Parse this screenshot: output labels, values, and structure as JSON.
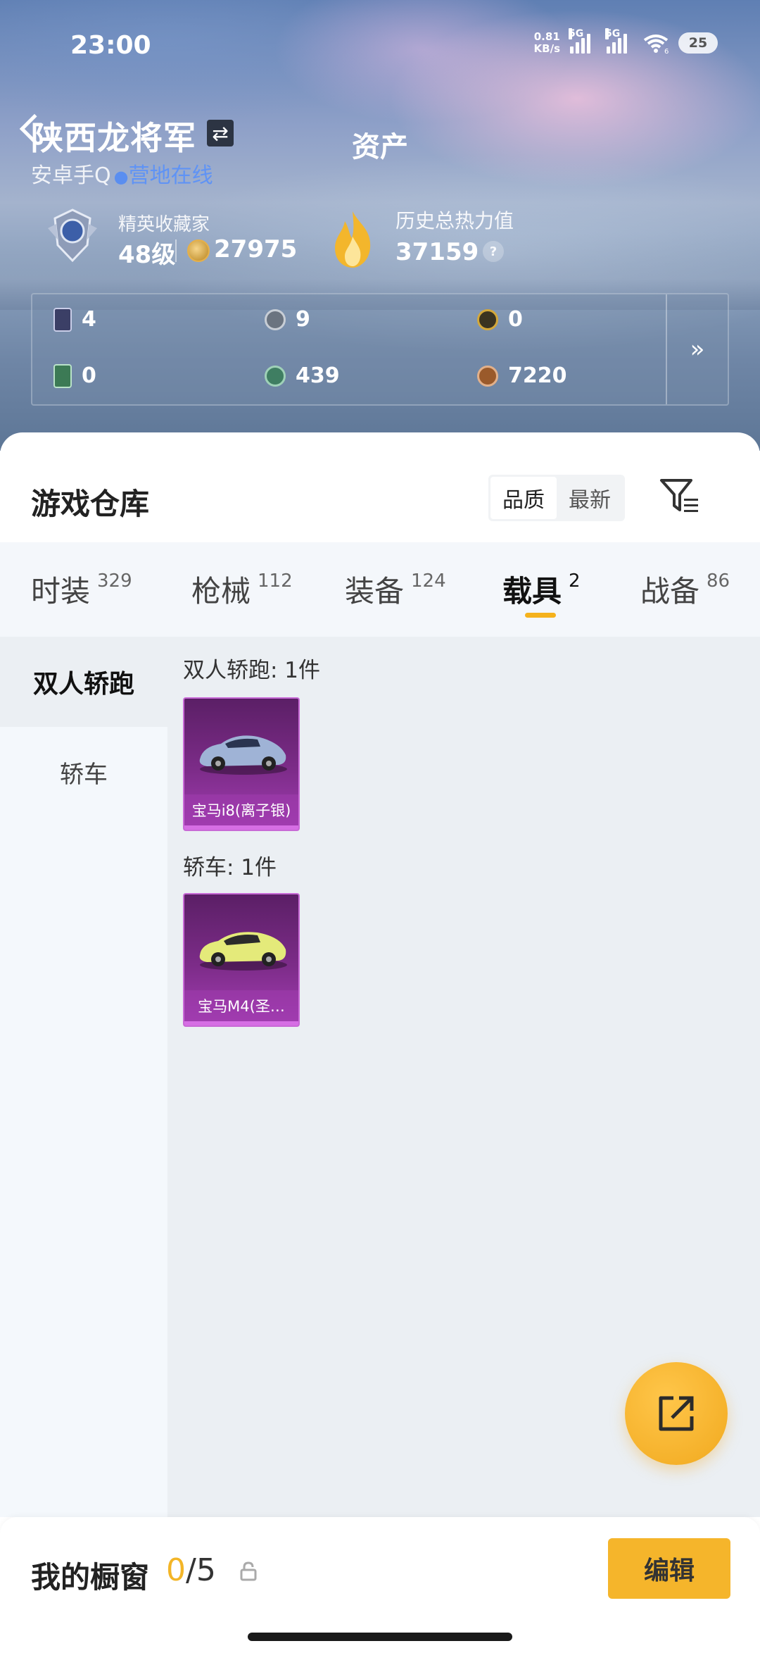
{
  "status_bar": {
    "time": "23:00",
    "net_speed_value": "0.81",
    "net_speed_unit": "KB/s",
    "sim1": "5G",
    "sim2": "5G",
    "wifi_badge": "6",
    "battery": "25"
  },
  "header": {
    "page_title": "资产",
    "player_name": "陕西龙将军",
    "switch_icon": "⇄",
    "platform": "安卓手Q",
    "online_status": "营地在线"
  },
  "rank": {
    "label": "精英收藏家",
    "level": "48级",
    "points": "27975"
  },
  "heat": {
    "label": "历史总热力值",
    "value": "37159",
    "help": "?"
  },
  "assets": [
    {
      "icon": "card-icon",
      "value": "4",
      "color": "#3b3f66"
    },
    {
      "icon": "silver-token-icon",
      "value": "9",
      "color": "#6b7480"
    },
    {
      "icon": "gold-token-icon",
      "value": "0",
      "color": "#b38a2a"
    },
    {
      "icon": "green-card-icon",
      "value": "0",
      "color": "#3c7a55"
    },
    {
      "icon": "jade-token-icon",
      "value": "439",
      "color": "#3f7e62"
    },
    {
      "icon": "bronze-token-icon",
      "value": "7220",
      "color": "#9a5a2b"
    }
  ],
  "assets_more": "»",
  "warehouse": {
    "title": "游戏仓库",
    "sort_options": [
      "品质",
      "最新"
    ],
    "sort_selected": "品质"
  },
  "tabs": [
    {
      "label": "时装",
      "count": "329"
    },
    {
      "label": "枪械",
      "count": "112"
    },
    {
      "label": "装备",
      "count": "124"
    },
    {
      "label": "载具",
      "count": "2",
      "active": true
    },
    {
      "label": "战备",
      "count": "86"
    }
  ],
  "categories": [
    {
      "label": "双人轿跑",
      "active": true
    },
    {
      "label": "轿车"
    }
  ],
  "sections": [
    {
      "title": "双人轿跑: 1件",
      "item": {
        "name": "宝马i8(离子银)",
        "car_color": "#9fb3d6"
      }
    },
    {
      "title": "轿车: 1件",
      "item": {
        "name": "宝马M4(圣…",
        "car_color": "#e4ea7a"
      }
    }
  ],
  "showcase": {
    "label": "我的橱窗",
    "current": "0",
    "separator_total": "/5",
    "edit_label": "编辑"
  },
  "colors": {
    "accent": "#f5b52b",
    "online": "#5f93f5",
    "card_purple": "#7d2c89"
  }
}
